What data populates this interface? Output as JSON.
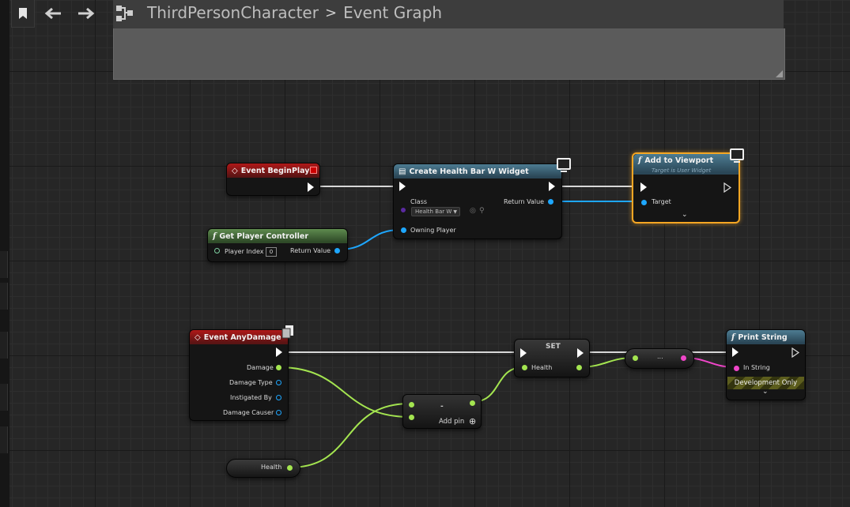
{
  "header": {
    "breadcrumb_root": "ThirdPersonCharacter",
    "breadcrumb_separator": ">",
    "breadcrumb_current": "Event Graph"
  },
  "icons": {
    "bookmark": "bookmark-icon",
    "back": "arrow-left-icon",
    "forward": "arrow-right-icon",
    "graph": "graph-hierarchy-icon"
  },
  "colors": {
    "event_header": "#b01818",
    "function_header": "#4d7c92",
    "pure_header": "#5e8b4e",
    "exec_wire": "#d8d8d8",
    "object_wire": "#1ea7ff",
    "float_wire": "#a4e550",
    "string_wire": "#f046c9",
    "selection": "#f5a623"
  },
  "nodes": {
    "begin_play": {
      "title": "Event BeginPlay"
    },
    "create_widget": {
      "title": "Create Health Bar W Widget",
      "class_label": "Class",
      "class_value": "Health Bar W",
      "return_label": "Return Value",
      "owning_player_label": "Owning Player"
    },
    "add_to_viewport": {
      "title": "Add to Viewport",
      "subtitle": "Target is User Widget",
      "target_label": "Target"
    },
    "get_player_controller": {
      "title": "Get Player Controller",
      "player_index_label": "Player Index",
      "player_index_value": "0",
      "return_label": "Return Value"
    },
    "any_damage": {
      "title": "Event AnyDamage",
      "pins": [
        "Damage",
        "Damage Type",
        "Instigated By",
        "Damage Causer"
      ]
    },
    "subtract": {
      "op": "-",
      "add_pin_label": "Add pin"
    },
    "set_health": {
      "title": "SET",
      "pin_label": "Health"
    },
    "conversion": {
      "label": "..."
    },
    "print_string": {
      "title": "Print String",
      "in_string_label": "In String",
      "dev_only_label": "Development Only"
    },
    "get_health": {
      "label": "Health"
    }
  }
}
